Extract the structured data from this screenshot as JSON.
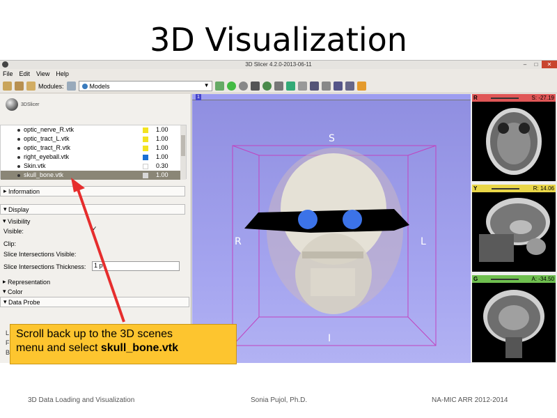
{
  "slide": {
    "title": "3D Visualization",
    "footer_left": "3D Data Loading and Visualization",
    "footer_center": "Sonia Pujol, Ph.D.",
    "footer_right": "NA-MIC ARR 2012-2014"
  },
  "window": {
    "title": "3D Slicer 4.2.0-2013-06-11"
  },
  "menu": [
    "File",
    "Edit",
    "View",
    "Help"
  ],
  "toolbar": {
    "modules_label": "Modules:",
    "module_selected": "Models"
  },
  "left_panel": {
    "logo_text": "3DSlicer",
    "scene_items": [
      {
        "name": "optic_nerve_R.vtk",
        "color": "#f3e321",
        "opacity": "1.00"
      },
      {
        "name": "optic_tract_L.vtk",
        "color": "#f3e321",
        "opacity": "1.00"
      },
      {
        "name": "optic_tract_R.vtk",
        "color": "#f3e321",
        "opacity": "1.00"
      },
      {
        "name": "right_eyeball.vtk",
        "color": "#1a6fd4",
        "opacity": "1.00"
      },
      {
        "name": "Skin.vtk",
        "color": "#ffffff",
        "opacity": "0.30"
      },
      {
        "name": "skull_bone.vtk",
        "color": "#d8d8d8",
        "opacity": "1.00",
        "selected": true
      }
    ],
    "sections": {
      "information": "Information",
      "display": "Display",
      "visibility": "Visibility",
      "visible_label": "Visible:",
      "clip_label": "Clip:",
      "slice_int_visible_label": "Slice Intersections Visible:",
      "slice_int_thickness_label": "Slice Intersections Thickness:",
      "slice_int_thickness_value": "1 p",
      "representation": "Representation",
      "color": "Color",
      "data_probe": "Data Probe"
    },
    "behind_callout": [
      "L",
      "F",
      "B"
    ]
  },
  "view3d": {
    "badge": "1",
    "labels": {
      "S": "S",
      "R": "R",
      "L": "L",
      "I": "I"
    }
  },
  "slice_views": [
    {
      "letter": "R",
      "value": "S: -27.19",
      "bar_color": "#e05757"
    },
    {
      "letter": "Y",
      "value": "R: 14.06",
      "bar_color": "#e9d648"
    },
    {
      "letter": "G",
      "value": "A: -34.50",
      "bar_color": "#6fbf4f"
    }
  ],
  "callout": {
    "line1": "Scroll back up to the 3D scenes",
    "line2_prefix": "menu and select ",
    "line2_bold": "skull_bone.vtk"
  }
}
